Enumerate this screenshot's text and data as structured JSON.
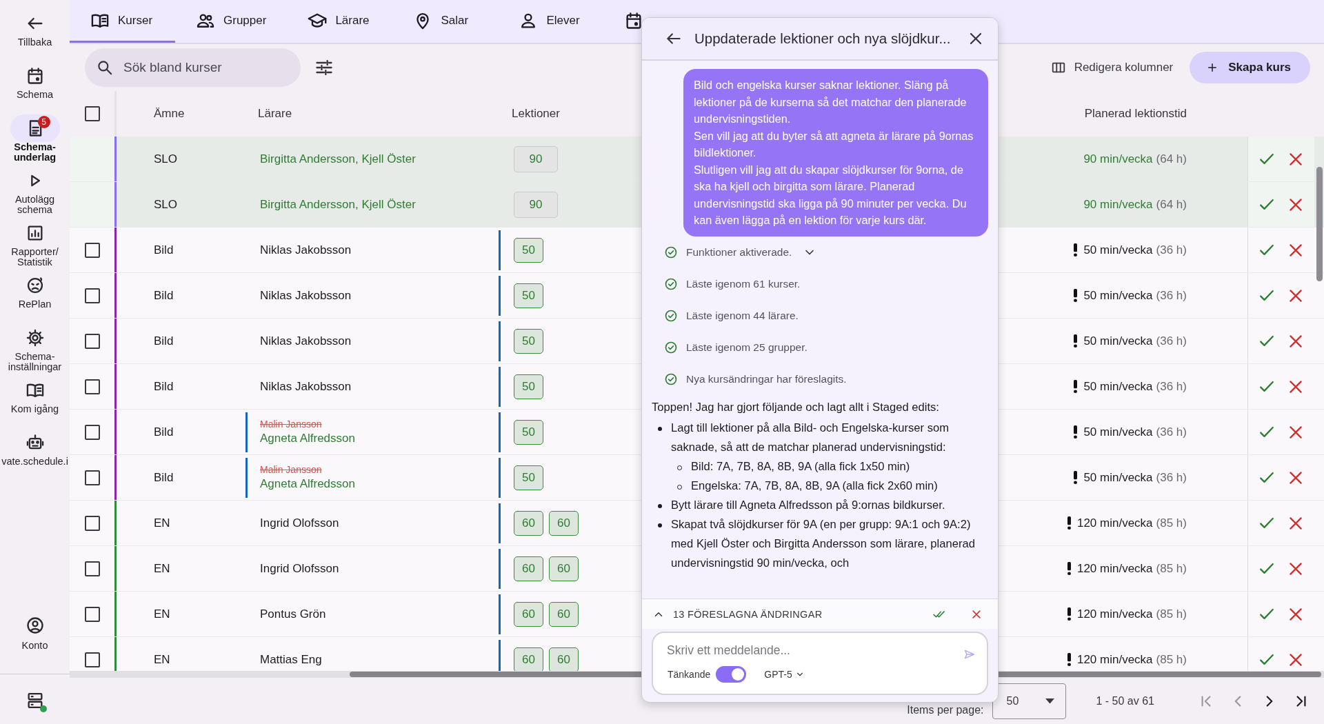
{
  "sidebar": {
    "items": [
      {
        "label": "Tillbaka",
        "selected": false
      },
      {
        "label": "Schema",
        "selected": false
      },
      {
        "label": "Schema-underlag",
        "selected": true,
        "badge": "5"
      },
      {
        "label": "Autolägg schema",
        "selected": false
      },
      {
        "label": "Rapporter/ Statistik",
        "selected": false
      },
      {
        "label": "RePlan",
        "selected": false
      },
      {
        "label": "Schema-inställningar",
        "selected": false
      },
      {
        "label": "Kom igång",
        "selected": false
      },
      {
        "label": "vate.schedule.i",
        "selected": false
      }
    ],
    "account": {
      "label": "Konto"
    },
    "server": {
      "online": true
    }
  },
  "tabs": [
    {
      "label": "Kurser",
      "selected": true
    },
    {
      "label": "Grupper",
      "selected": false
    },
    {
      "label": "Lärare",
      "selected": false
    },
    {
      "label": "Salar",
      "selected": false
    },
    {
      "label": "Elever",
      "selected": false
    },
    {
      "selected": false
    }
  ],
  "search": {
    "placeholder": "Sök bland kurser"
  },
  "toolbar": {
    "edit_columns": "Redigera kolumner",
    "create": "Skapa kurs"
  },
  "table": {
    "all_checked": false,
    "columns": [
      "Ämne",
      "Lärare",
      "Lektioner",
      "Planerad lektionstid"
    ],
    "rows": [
      {
        "kind": "new",
        "subject": "SLO",
        "color": "#8b6cf5",
        "teachers": [
          {
            "name": "Birgitta Andersson, Kjell Öster",
            "kind": "added"
          }
        ],
        "teacher_changed": false,
        "lessons": [
          "90"
        ],
        "lessons_changed": false,
        "planned": "90 min/vecka",
        "hours": "(64 h)",
        "warning": false
      },
      {
        "kind": "new",
        "subject": "SLO",
        "color": "#8b6cf5",
        "teachers": [
          {
            "name": "Birgitta Andersson, Kjell Öster",
            "kind": "added"
          }
        ],
        "teacher_changed": false,
        "lessons": [
          "90"
        ],
        "lessons_changed": false,
        "planned": "90 min/vecka",
        "hours": "(64 h)",
        "warning": false
      },
      {
        "kind": "existing",
        "checked": false,
        "subject": "Bild",
        "color": "#8e24aa",
        "teachers": [
          {
            "name": "Niklas Jakobsson",
            "kind": "same"
          }
        ],
        "teacher_changed": false,
        "lessons": [
          "50"
        ],
        "lessons_changed": true,
        "planned": "50 min/vecka",
        "hours": "(36 h)",
        "warning": true
      },
      {
        "kind": "existing",
        "checked": false,
        "subject": "Bild",
        "color": "#8e24aa",
        "teachers": [
          {
            "name": "Niklas Jakobsson",
            "kind": "same"
          }
        ],
        "teacher_changed": false,
        "lessons": [
          "50"
        ],
        "lessons_changed": true,
        "planned": "50 min/vecka",
        "hours": "(36 h)",
        "warning": true
      },
      {
        "kind": "existing",
        "checked": false,
        "subject": "Bild",
        "color": "#8e24aa",
        "teachers": [
          {
            "name": "Niklas Jakobsson",
            "kind": "same"
          }
        ],
        "teacher_changed": false,
        "lessons": [
          "50"
        ],
        "lessons_changed": true,
        "planned": "50 min/vecka",
        "hours": "(36 h)",
        "warning": true
      },
      {
        "kind": "existing",
        "checked": false,
        "subject": "Bild",
        "color": "#8e24aa",
        "teachers": [
          {
            "name": "Niklas Jakobsson",
            "kind": "same"
          }
        ],
        "teacher_changed": false,
        "lessons": [
          "50"
        ],
        "lessons_changed": true,
        "planned": "50 min/vecka",
        "hours": "(36 h)",
        "warning": true
      },
      {
        "kind": "existing",
        "checked": false,
        "subject": "Bild",
        "color": "#8e24aa",
        "teachers": [
          {
            "name": "Malin Jansson",
            "kind": "removed"
          },
          {
            "name": "Agneta Alfredsson",
            "kind": "added"
          }
        ],
        "teacher_changed": true,
        "lessons": [
          "50"
        ],
        "lessons_changed": true,
        "planned": "50 min/vecka",
        "hours": "(36 h)",
        "warning": true
      },
      {
        "kind": "existing",
        "checked": false,
        "subject": "Bild",
        "color": "#8e24aa",
        "teachers": [
          {
            "name": "Malin Jansson",
            "kind": "removed"
          },
          {
            "name": "Agneta Alfredsson",
            "kind": "added"
          }
        ],
        "teacher_changed": true,
        "lessons": [
          "50"
        ],
        "lessons_changed": true,
        "planned": "50 min/vecka",
        "hours": "(36 h)",
        "warning": true
      },
      {
        "kind": "existing",
        "checked": false,
        "subject": "EN",
        "color": "#2e8b3e",
        "teachers": [
          {
            "name": "Ingrid Olofsson",
            "kind": "same"
          }
        ],
        "teacher_changed": false,
        "lessons": [
          "60",
          "60"
        ],
        "lessons_changed": true,
        "planned": "120 min/vecka",
        "hours": "(85 h)",
        "warning": true
      },
      {
        "kind": "existing",
        "checked": false,
        "subject": "EN",
        "color": "#2e8b3e",
        "teachers": [
          {
            "name": "Ingrid Olofsson",
            "kind": "same"
          }
        ],
        "teacher_changed": false,
        "lessons": [
          "60",
          "60"
        ],
        "lessons_changed": true,
        "planned": "120 min/vecka",
        "hours": "(85 h)",
        "warning": true
      },
      {
        "kind": "existing",
        "checked": false,
        "subject": "EN",
        "color": "#2e8b3e",
        "teachers": [
          {
            "name": "Pontus Grön",
            "kind": "same"
          }
        ],
        "teacher_changed": false,
        "lessons": [
          "60",
          "60"
        ],
        "lessons_changed": true,
        "planned": "120 min/vecka",
        "hours": "(85 h)",
        "warning": true
      },
      {
        "kind": "existing",
        "checked": false,
        "subject": "EN",
        "color": "#2e8b3e",
        "teachers": [
          {
            "name": "Mattias Eng",
            "kind": "same"
          }
        ],
        "teacher_changed": false,
        "lessons": [
          "60",
          "60"
        ],
        "lessons_changed": true,
        "planned": "120 min/vecka",
        "hours": "(85 h)",
        "warning": true
      }
    ]
  },
  "pagination": {
    "items_per_page": "Items per page:",
    "per_page": "50",
    "range": "1 - 50 av 61",
    "first_disabled": true,
    "prev_disabled": true,
    "next_disabled": false,
    "last_disabled": false
  },
  "chat": {
    "title": "Uppdaterade lektioner och nya slöjdkur...",
    "user_message": [
      "Bild och engelska kurser saknar lektioner. Släng på lektioner på de kurserna så det matchar den planerade undervisningstiden.",
      "Sen vill jag att du byter så att agneta är lärare på 9ornas bildlektioner.",
      "Slutligen vill jag att du skapar slöjdkurser för 9orna, de ska ha kjell och birgitta som lärare. Planerad undervisningstid ska ligga på 90 minuter per vecka. Du kan även lägga på en lektion för varje kurs där."
    ],
    "steps": [
      {
        "text": "Funktioner aktiverade.",
        "kind": "expandable"
      },
      {
        "text": "Läste igenom 61 kurser.",
        "kind": "done"
      },
      {
        "text": "Läste igenom 44 lärare.",
        "kind": "done"
      },
      {
        "text": "Läste igenom 25 grupper.",
        "kind": "done"
      },
      {
        "text": "Nya kursändringar har föreslagits.",
        "kind": "done"
      }
    ],
    "reply_intro": "Toppen! Jag har gjort följande och lagt allt i Staged edits:",
    "reply_items": [
      {
        "text": "Lagt till lektioner på alla Bild- och Engelska-kurser som saknade, så att de matchar planerad undervisningstid:",
        "children": [
          {
            "text": "Bild: 7A, 7B, 8A, 8B, 9A (alla fick 1x50 min)"
          },
          {
            "text": "Engelska: 7A, 7B, 8A, 8B, 9A (alla fick 2x60 min)"
          }
        ]
      },
      {
        "text": "Bytt lärare till Agneta Alfredsson på 9:ornas bildkurser."
      },
      {
        "text": "Skapat två slöjdkurser för 9A (en per grupp: 9A:1 och 9A:2) med Kjell Öster och Birgitta Andersson som lärare, planerad undervisningstid 90 min/vecka, och"
      }
    ],
    "staged": {
      "label": "13 FÖRESLAGNA ÄNDRINGAR",
      "expanded": false
    },
    "input": {
      "placeholder": "Skriv ett meddelande..."
    },
    "thinking": {
      "label": "Tänkande",
      "on": true
    },
    "model": "GPT-5"
  }
}
